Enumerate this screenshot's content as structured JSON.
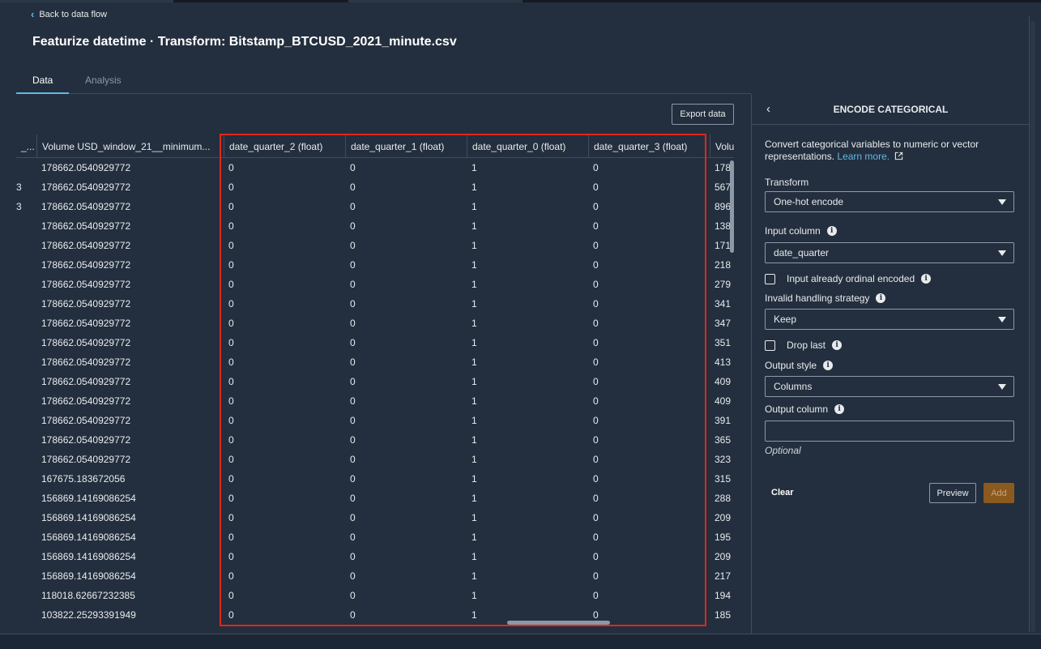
{
  "header": {
    "back_label": "Back to data flow",
    "title": "Featurize datetime · Transform: Bitstamp_BTCUSD_2021_minute.csv"
  },
  "tabs": [
    {
      "label": "Data",
      "active": true
    },
    {
      "label": "Analysis",
      "active": false
    }
  ],
  "toolbar": {
    "export_label": "Export data"
  },
  "table": {
    "columns": [
      "_...",
      "Volume USD_window_21__minimum...",
      "date_quarter_2 (float)",
      "date_quarter_1 (float)",
      "date_quarter_0 (float)",
      "date_quarter_3 (float)",
      "Volu"
    ],
    "rows": [
      [
        "",
        "178662.0540929772",
        "0",
        "0",
        "1",
        "0",
        "178"
      ],
      [
        "3",
        "178662.0540929772",
        "0",
        "0",
        "1",
        "0",
        "567"
      ],
      [
        "3",
        "178662.0540929772",
        "0",
        "0",
        "1",
        "0",
        "896"
      ],
      [
        "",
        "178662.0540929772",
        "0",
        "0",
        "1",
        "0",
        "138"
      ],
      [
        "",
        "178662.0540929772",
        "0",
        "0",
        "1",
        "0",
        "171"
      ],
      [
        "",
        "178662.0540929772",
        "0",
        "0",
        "1",
        "0",
        "218"
      ],
      [
        "",
        "178662.0540929772",
        "0",
        "0",
        "1",
        "0",
        "279"
      ],
      [
        "",
        "178662.0540929772",
        "0",
        "0",
        "1",
        "0",
        "341"
      ],
      [
        "",
        "178662.0540929772",
        "0",
        "0",
        "1",
        "0",
        "347"
      ],
      [
        "",
        "178662.0540929772",
        "0",
        "0",
        "1",
        "0",
        "351"
      ],
      [
        "",
        "178662.0540929772",
        "0",
        "0",
        "1",
        "0",
        "413"
      ],
      [
        "",
        "178662.0540929772",
        "0",
        "0",
        "1",
        "0",
        "409"
      ],
      [
        "",
        "178662.0540929772",
        "0",
        "0",
        "1",
        "0",
        "409"
      ],
      [
        "",
        "178662.0540929772",
        "0",
        "0",
        "1",
        "0",
        "391"
      ],
      [
        "",
        "178662.0540929772",
        "0",
        "0",
        "1",
        "0",
        "365"
      ],
      [
        "",
        "178662.0540929772",
        "0",
        "0",
        "1",
        "0",
        "323"
      ],
      [
        "",
        "167675.183672056",
        "0",
        "0",
        "1",
        "0",
        "315"
      ],
      [
        "",
        "156869.14169086254",
        "0",
        "0",
        "1",
        "0",
        "288"
      ],
      [
        "",
        "156869.14169086254",
        "0",
        "0",
        "1",
        "0",
        "209"
      ],
      [
        "",
        "156869.14169086254",
        "0",
        "0",
        "1",
        "0",
        "195"
      ],
      [
        "",
        "156869.14169086254",
        "0",
        "0",
        "1",
        "0",
        "209"
      ],
      [
        "",
        "156869.14169086254",
        "0",
        "0",
        "1",
        "0",
        "217"
      ],
      [
        "",
        "118018.62667232385",
        "0",
        "0",
        "1",
        "0",
        "194"
      ],
      [
        "",
        "103822.25293391949",
        "0",
        "0",
        "1",
        "0",
        "185"
      ]
    ]
  },
  "panel": {
    "title": "ENCODE CATEGORICAL",
    "description": "Convert categorical variables to numeric or vector representations.",
    "learn_more": "Learn more.",
    "transform_label": "Transform",
    "transform_value": "One-hot encode",
    "input_column_label": "Input column",
    "input_column_value": "date_quarter",
    "ordinal_label": "Input already ordinal encoded",
    "ordinal_checked": false,
    "invalid_label": "Invalid handling strategy",
    "invalid_value": "Keep",
    "drop_last_label": "Drop last",
    "drop_last_checked": false,
    "output_style_label": "Output style",
    "output_style_value": "Columns",
    "output_column_label": "Output column",
    "output_column_value": "",
    "optional_text": "Optional",
    "clear_label": "Clear",
    "preview_label": "Preview",
    "add_label": "Add"
  },
  "colors": {
    "background": "#232f3e",
    "accent": "#5fb9e5",
    "highlight_box": "#e0281a",
    "add_button": "#8a5a1f"
  }
}
